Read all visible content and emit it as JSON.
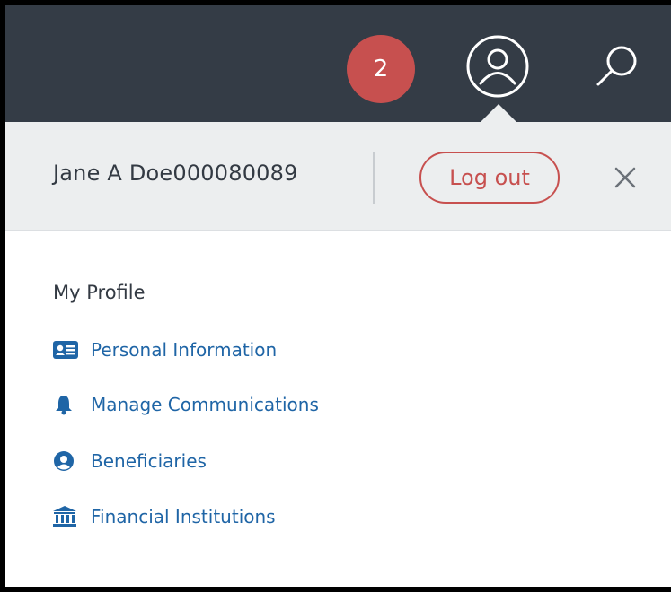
{
  "header": {
    "notification_count": "2",
    "icons": [
      "notification-badge",
      "user-circle-icon",
      "search-icon"
    ],
    "colors": {
      "bar": "#343c46",
      "badge": "#c7504f"
    }
  },
  "account": {
    "user_name": "Jane A Doe000080089",
    "logout_label": "Log out",
    "close_icon": "close-icon"
  },
  "menu": {
    "title": "My Profile",
    "items": [
      {
        "label": "Personal Information",
        "icon": "id-card-icon"
      },
      {
        "label": "Manage Communications",
        "icon": "bell-icon"
      },
      {
        "label": "Beneficiaries",
        "icon": "user-circle-icon"
      },
      {
        "label": "Financial Institutions",
        "icon": "bank-icon"
      }
    ],
    "link_color": "#1f65a6"
  }
}
